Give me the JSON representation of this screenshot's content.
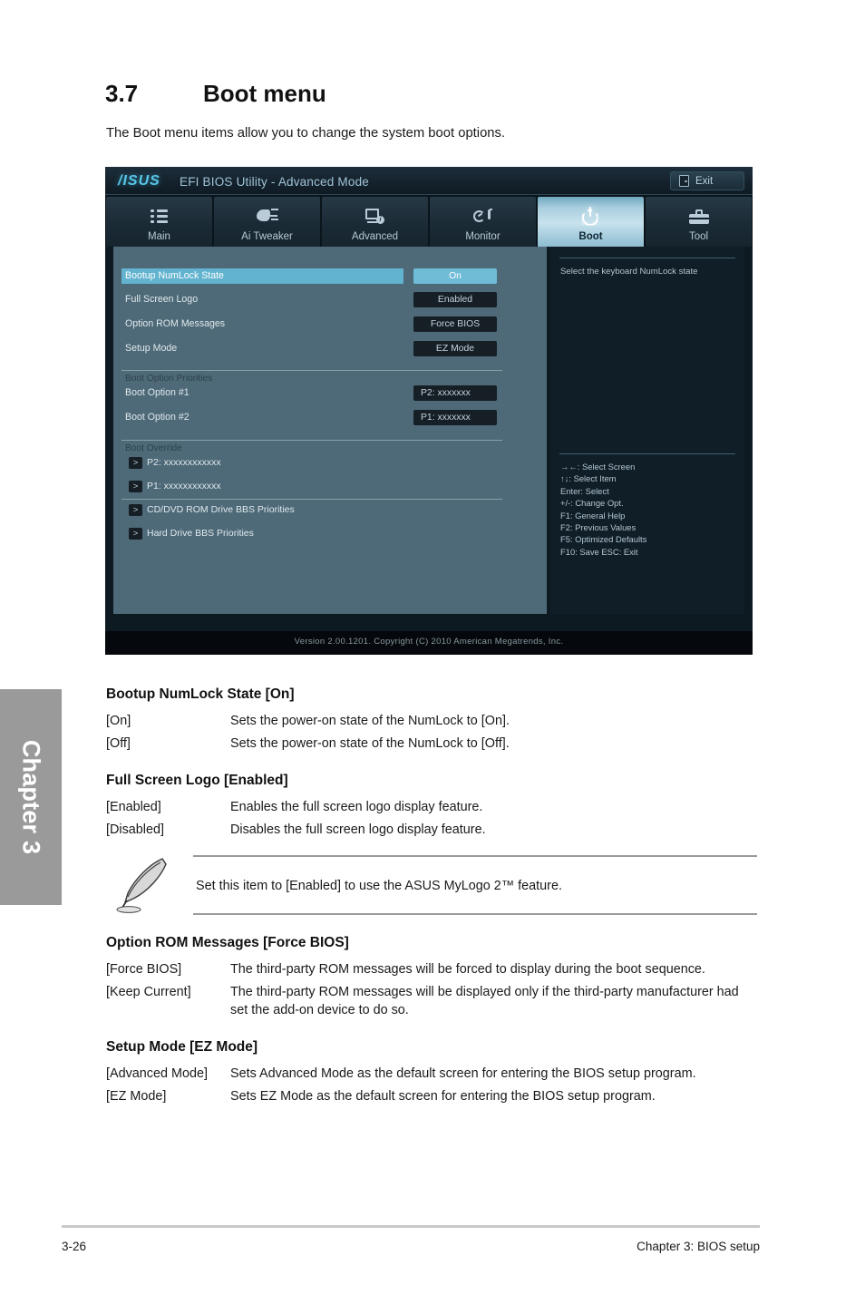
{
  "section": {
    "number": "3.7",
    "title": "Boot menu",
    "intro": "The Boot menu items allow you to change the system boot options."
  },
  "chapter_tab": {
    "label": "Chapter 3"
  },
  "bios": {
    "brand": "/ISUS",
    "title": "EFI BIOS Utility - Advanced Mode",
    "exit_label": "Exit",
    "tabs": [
      {
        "label": "Main",
        "icon": "list-icon",
        "active": false
      },
      {
        "label": "Ai  Tweaker",
        "icon": "tweaker-icon",
        "active": false
      },
      {
        "label": "Advanced",
        "icon": "advanced-monitor-icon",
        "active": false
      },
      {
        "label": "Monitor",
        "icon": "thermometer-gauge-icon",
        "active": false
      },
      {
        "label": "Boot",
        "icon": "power-icon",
        "active": true
      },
      {
        "label": "Tool",
        "icon": "toolbox-icon",
        "active": false
      }
    ],
    "settings": [
      {
        "label": "Bootup NumLock State",
        "value": "On",
        "selected": true
      },
      {
        "label": "Full Screen Logo",
        "value": "Enabled",
        "selected": false
      },
      {
        "label": "Option ROM Messages",
        "value": "Force BIOS",
        "selected": false
      },
      {
        "label": "Setup Mode",
        "value": "EZ Mode",
        "selected": false
      }
    ],
    "boot_priorities_title": "Boot Option Priorities",
    "boot_priorities": [
      {
        "label": "Boot Option #1",
        "value": "P2: xxxxxxx"
      },
      {
        "label": "Boot Option #2",
        "value": "P1: xxxxxxx"
      }
    ],
    "boot_override_title": "Boot Override",
    "boot_override": [
      {
        "chevron": ">",
        "label": "P2: xxxxxxxxxxxx"
      },
      {
        "chevron": ">",
        "label": "P1: xxxxxxxxxxxx"
      }
    ],
    "bbs_items": [
      {
        "chevron": ">",
        "label": "CD/DVD ROM Drive BBS Priorities"
      },
      {
        "chevron": ">",
        "label": "Hard Drive BBS Priorities"
      }
    ],
    "help_text": "Select the keyboard NumLock state",
    "key_legend": [
      "→←:  Select Screen",
      "↑↓:  Select Item",
      "Enter:  Select",
      "+/-:  Change Opt.",
      "F1:  General Help",
      "F2:  Previous Values",
      "F5:  Optimized Defaults",
      "F10:  Save    ESC:  Exit"
    ],
    "footer": "Version  2.00.1201.   Copyright  (C)  2010  American  Megatrends,  Inc."
  },
  "doc": {
    "blocks": [
      {
        "heading": "Bootup NumLock State [On]",
        "rows": [
          {
            "key": "[On]",
            "desc": "Sets the power-on state of the NumLock to [On]."
          },
          {
            "key": "[Off]",
            "desc": "Sets the power-on state of the NumLock to [Off]."
          }
        ]
      },
      {
        "heading": "Full Screen Logo [Enabled]",
        "rows": [
          {
            "key": "[Enabled]",
            "desc": "Enables the full screen logo display feature."
          },
          {
            "key": "[Disabled]",
            "desc": "Disables the full screen logo display feature."
          }
        ]
      },
      {
        "heading": "Option ROM Messages [Force BIOS]",
        "rows": [
          {
            "key": "[Force BIOS]",
            "desc": "The third-party ROM messages will be forced to display during the boot sequence."
          },
          {
            "key": "[Keep Current]",
            "desc": "The third-party ROM messages will be displayed only if the third-party manufacturer had set the add-on device to do so."
          }
        ]
      },
      {
        "heading": "Setup Mode [EZ Mode]",
        "rows": [
          {
            "key": "[Advanced Mode]",
            "desc": "Sets Advanced Mode as the default screen for entering the BIOS setup program."
          },
          {
            "key": "[EZ Mode]",
            "desc": "Sets EZ Mode as the default screen for entering the BIOS setup program."
          }
        ]
      }
    ],
    "note": "Set this item to [Enabled] to use the ASUS MyLogo 2™ feature."
  },
  "page_footer": {
    "page_number": "3-26",
    "chapter_label": "Chapter 3: BIOS setup"
  }
}
